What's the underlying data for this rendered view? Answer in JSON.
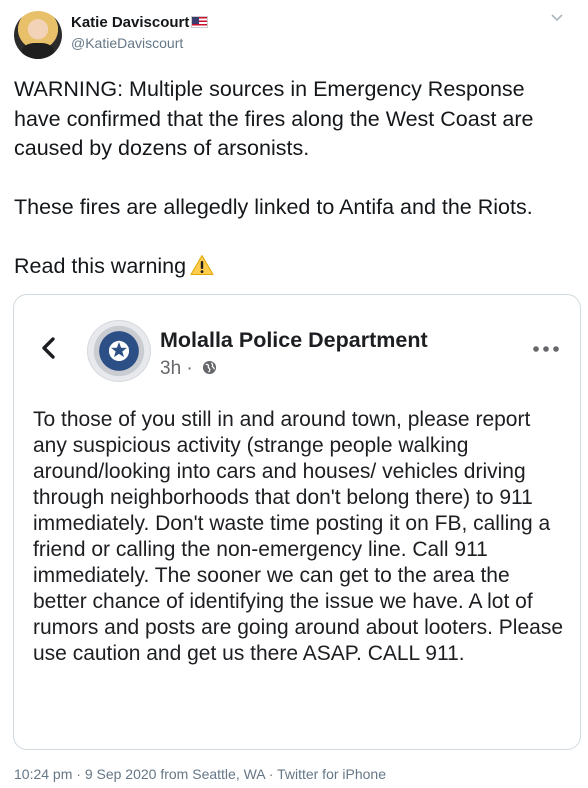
{
  "author": {
    "display_name": "Katie Daviscourt",
    "handle": "@KatieDaviscourt",
    "flag": "us-flag-icon"
  },
  "tweet": {
    "paragraph1": "WARNING: Multiple sources in Emergency Response have confirmed that the fires along the West Coast are caused by dozens of arsonists.",
    "paragraph2": "These fires are allegedly linked to Antifa and the Riots.",
    "paragraph3": "Read this warning",
    "emoji": "warning-icon"
  },
  "embedded_post": {
    "page_name": "Molalla Police Department",
    "time": "3h",
    "separator": "·",
    "privacy": "globe-icon",
    "text": "To those of you still in and around town, please report any suspicious activity (strange people walking around/looking into cars and houses/ vehicles driving through neighborhoods that don't belong there) to 911 immediately.  Don't waste time posting it on FB, calling a friend or calling the non-emergency line.  Call 911 immediately.  The sooner we can get to the area the better chance of identifying the issue we have.  A lot of rumors and posts are going around about looters.  Please use caution and get us there ASAP.  CALL 911."
  },
  "footer": {
    "time": "10:24 pm",
    "sep1": "·",
    "date": "9 Sep 2020",
    "location": "from Seattle, WA",
    "sep2": "·",
    "client": "Twitter for iPhone"
  },
  "colors": {
    "text": "#14171a",
    "muted": "#657786",
    "border": "#cfd9de",
    "fb_text": "#1c1e21"
  }
}
